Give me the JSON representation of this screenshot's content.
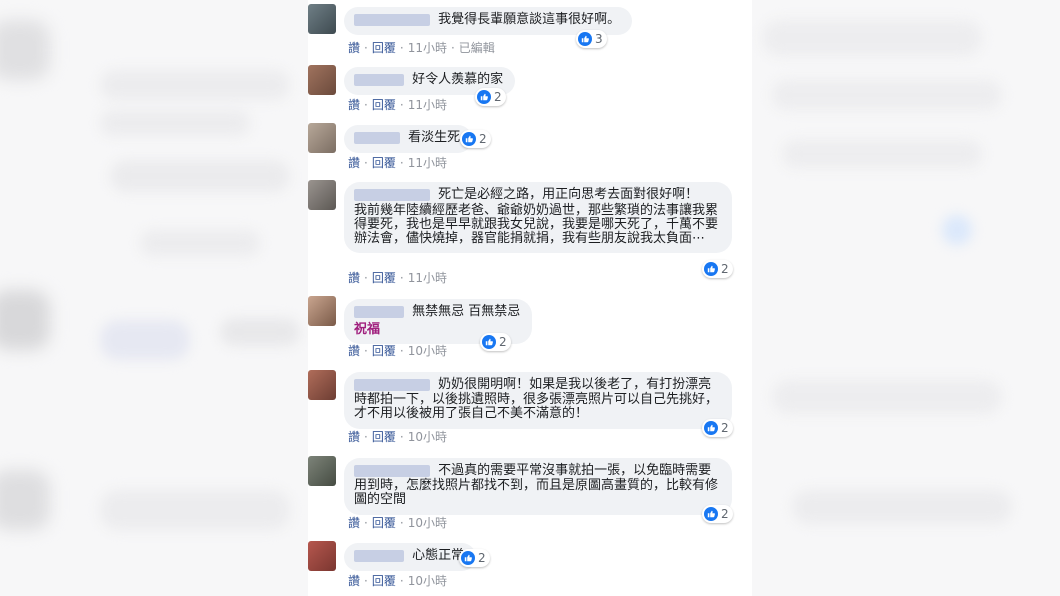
{
  "colors": {
    "bubble": "#f0f2f5",
    "link": "#385898",
    "like": "#1877f2",
    "highlight": "#a0207e"
  },
  "actions": {
    "like": "讚",
    "reply": "回覆",
    "sep": "·"
  },
  "comments": [
    {
      "text": "我覺得長輩願意談這事很好啊。",
      "time": "11小時",
      "edited": "已編輯",
      "reactions": "3"
    },
    {
      "text": "好令人羨慕的家",
      "time": "11小時",
      "reactions": "2"
    },
    {
      "text": "看淡生死",
      "time": "11小時",
      "reactions": "2"
    },
    {
      "text": "死亡是必經之路，用正向思考去面對很好啊！",
      "text2": "我前幾年陸續經歷老爸、爺爺奶奶過世，那些繁瑣的法事讓我累得要死，我也是早早就跟我女兒說，我要是哪天死了，千萬不要辦法會，儘快燒掉，器官能捐就捐，我有些朋友說我太負面⋯",
      "time": "11小時",
      "reactions": "2"
    },
    {
      "text": "無禁無忌 百無禁忌",
      "extra": "祝福",
      "time": "10小時",
      "reactions": "2"
    },
    {
      "text": "奶奶很開明啊！如果是我以後老了，有打扮漂亮時都拍一下，以後挑遺照時，很多張漂亮照片可以自己先挑好，才不用以後被用了張自己不美不滿意的！",
      "time": "10小時",
      "reactions": "2"
    },
    {
      "text": "不過真的需要平常沒事就拍一張，以免臨時需要用到時，怎麼找照片都找不到，而且是原圖高畫質的，比較有修圖的空間",
      "time": "10小時",
      "reactions": "2"
    },
    {
      "text": "心態正常",
      "time": "10小時",
      "reactions": "2"
    }
  ]
}
